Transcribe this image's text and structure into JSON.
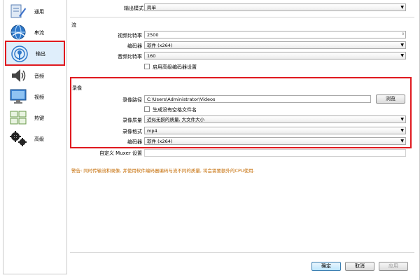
{
  "sidebar": {
    "items": [
      {
        "label": "通用",
        "icon": "general-icon"
      },
      {
        "label": "串流",
        "icon": "stream-icon"
      },
      {
        "label": "输出",
        "icon": "output-icon"
      },
      {
        "label": "音频",
        "icon": "audio-icon"
      },
      {
        "label": "视频",
        "icon": "video-icon"
      },
      {
        "label": "热键",
        "icon": "hotkeys-icon"
      },
      {
        "label": "高级",
        "icon": "advanced-icon"
      }
    ],
    "selected": "输出"
  },
  "output_mode": {
    "label": "输出模式",
    "value": "简单"
  },
  "stream": {
    "title": "流",
    "video_bitrate_label": "视频比特率",
    "video_bitrate": "2500",
    "encoder_label": "编码器",
    "encoder": "软件 (x264)",
    "audio_bitrate_label": "音频比特率",
    "audio_bitrate": "160",
    "advanced_encoder_label": "启用高级编码器设置"
  },
  "recording": {
    "title": "录像",
    "path_label": "录像路径",
    "path": "C:\\Users\\Administrator\\Videos",
    "browse_label": "浏览",
    "no_space_label": "生成没有空格文件名",
    "quality_label": "录像质量",
    "quality": "近似无损的质量, 大文件大小",
    "format_label": "录像格式",
    "format": "mp4",
    "encoder_label": "编码器",
    "encoder": "软件 (x264)",
    "muxer_label": "自定义 Muxer 设置",
    "muxer_value": ""
  },
  "warning": "警告: 同时传输流和录像, 并使用软件编码器编码与流不同的质量, 将会需要额外的CPU使用.",
  "buttons": {
    "ok": "确定",
    "cancel": "取消",
    "apply": "应用"
  },
  "colors": {
    "highlight": "#e0191f",
    "warning": "#c46a00",
    "selected_bg": "#dfeefb"
  }
}
